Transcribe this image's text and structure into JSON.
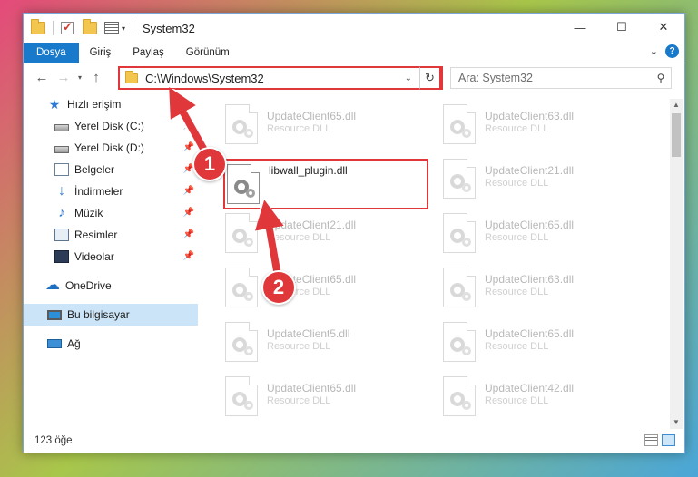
{
  "window": {
    "title": "System32",
    "controls": {
      "minimize": "—",
      "maximize": "☐",
      "close": "✕"
    }
  },
  "ribbon": {
    "tabs": [
      "Dosya",
      "Giriş",
      "Paylaş",
      "Görünüm"
    ],
    "help": "?"
  },
  "nav": {
    "back": "←",
    "forward": "→",
    "recent": "▾",
    "up": "↑",
    "address": "C:\\Windows\\System32",
    "refresh": "↻",
    "search_placeholder": "Ara: System32"
  },
  "sidebar": {
    "items": [
      {
        "label": "Hızlı erişim",
        "icon": "star-icon",
        "pinned": false
      },
      {
        "label": "Yerel Disk (C:)",
        "icon": "disk-icon",
        "pinned": true
      },
      {
        "label": "Yerel Disk (D:)",
        "icon": "disk-icon",
        "pinned": true
      },
      {
        "label": "Belgeler",
        "icon": "documents-icon",
        "pinned": true
      },
      {
        "label": "İndirmeler",
        "icon": "downloads-icon",
        "pinned": true
      },
      {
        "label": "Müzik",
        "icon": "music-icon",
        "pinned": true
      },
      {
        "label": "Resimler",
        "icon": "pictures-icon",
        "pinned": true
      },
      {
        "label": "Videolar",
        "icon": "videos-icon",
        "pinned": true
      },
      {
        "label": "OneDrive",
        "icon": "cloud-icon",
        "pinned": false
      },
      {
        "label": "Bu bilgisayar",
        "icon": "computer-icon",
        "pinned": false,
        "selected": true
      },
      {
        "label": "Ağ",
        "icon": "network-icon",
        "pinned": false
      }
    ]
  },
  "files": {
    "highlighted": {
      "name": "libwall_plugin.dll"
    },
    "faded": [
      {
        "name": "UpdateClient65.dll",
        "type": "Resource DLL"
      },
      {
        "name": "UpdateClient63.dll",
        "type": "Resource DLL"
      },
      {
        "name": "UpdateClient21.dll",
        "type": "Resource DLL"
      },
      {
        "name": "UpdateClient21.dll",
        "type": "Resource DLL"
      },
      {
        "name": "UpdateClient65.dll",
        "type": "Resource DLL"
      },
      {
        "name": "UpdateClient65.dll",
        "type": "Resource DLL"
      },
      {
        "name": "UpdateClient63.dll",
        "type": "Resource DLL"
      },
      {
        "name": "UpdateClient5.dll",
        "type": "Resource DLL"
      },
      {
        "name": "UpdateClient65.dll",
        "type": "Resource DLL"
      },
      {
        "name": "UpdateClient65.dll",
        "type": "Resource DLL"
      },
      {
        "name": "UpdateClient42.dll",
        "type": "Resource DLL"
      }
    ]
  },
  "status": {
    "count": "123 öğe"
  },
  "callouts": [
    "1",
    "2"
  ],
  "colors": {
    "accent": "#1979ca",
    "annotation": "#e0373b",
    "selection": "#cce4f7"
  }
}
